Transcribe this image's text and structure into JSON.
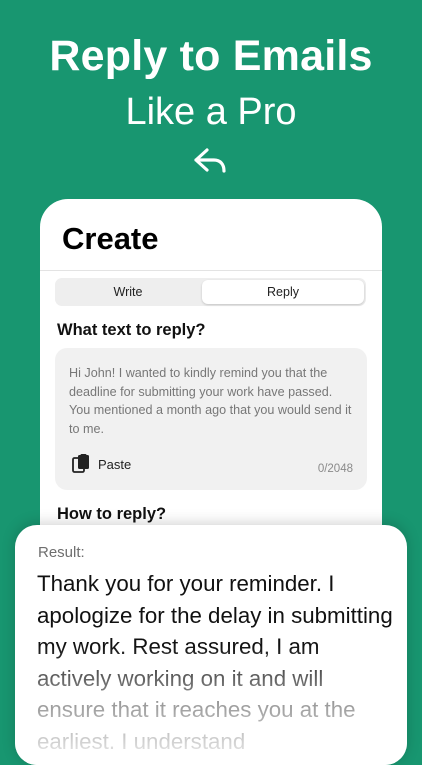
{
  "header": {
    "headline": "Reply to Emails",
    "subline": "Like a Pro",
    "icon": "reply-arrow-icon"
  },
  "screen": {
    "title": "Create",
    "tabs": [
      {
        "label": "Write",
        "selected": false
      },
      {
        "label": "Reply",
        "selected": true
      }
    ],
    "question_1": "What text to reply?",
    "input": {
      "value": "Hi John! I wanted to kindly remind you that the deadline for submitting your work have passed. You mentioned a month ago that you would send it to me.",
      "paste_label": "Paste",
      "paste_icon": "clipboard-paste-icon",
      "counter": "0/2048"
    },
    "question_2": "How to reply?"
  },
  "result": {
    "label": "Result:",
    "text": "Thank you for your reminder. I apologize for the delay in submitting my work. Rest assured, I am actively working on it and will ensure that it reaches you at the earliest. I understand"
  },
  "colors": {
    "background": "#189670",
    "card": "#ffffff",
    "input_bg": "#f1f1f1"
  }
}
